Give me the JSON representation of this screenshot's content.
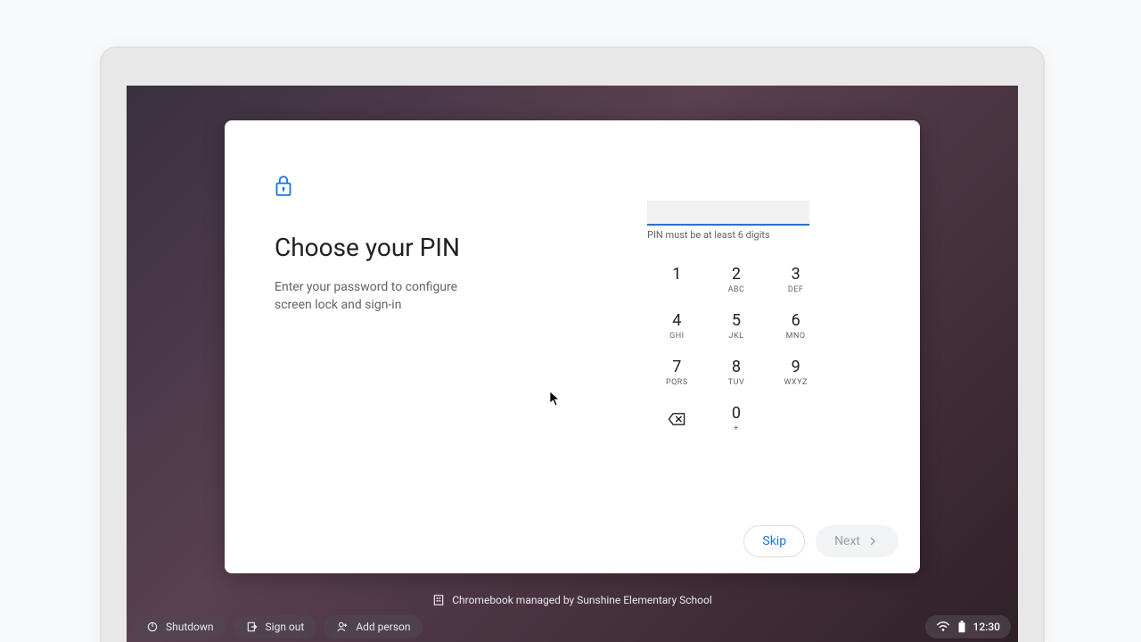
{
  "dialog": {
    "title": "Choose your PIN",
    "description": "Enter your password to configure screen lock and sign-in",
    "pin_value": "",
    "pin_hint": "PIN must be at least 6 digits"
  },
  "keypad": {
    "keys": [
      {
        "digit": "1",
        "letters": ""
      },
      {
        "digit": "2",
        "letters": "ABC"
      },
      {
        "digit": "3",
        "letters": "DEF"
      },
      {
        "digit": "4",
        "letters": "GHI"
      },
      {
        "digit": "5",
        "letters": "JKL"
      },
      {
        "digit": "6",
        "letters": "MNO"
      },
      {
        "digit": "7",
        "letters": "PQRS"
      },
      {
        "digit": "8",
        "letters": "TUV"
      },
      {
        "digit": "9",
        "letters": "WXYZ"
      },
      {
        "digit": "",
        "letters": ""
      },
      {
        "digit": "0",
        "letters": "+"
      },
      {
        "digit": "",
        "letters": ""
      }
    ]
  },
  "footer": {
    "skip_label": "Skip",
    "next_label": "Next"
  },
  "managed": {
    "text": "Chromebook managed by Sunshine Elementary School"
  },
  "shelf": {
    "shutdown_label": "Shutdown",
    "signout_label": "Sign out",
    "addperson_label": "Add person",
    "clock": "12:30"
  }
}
